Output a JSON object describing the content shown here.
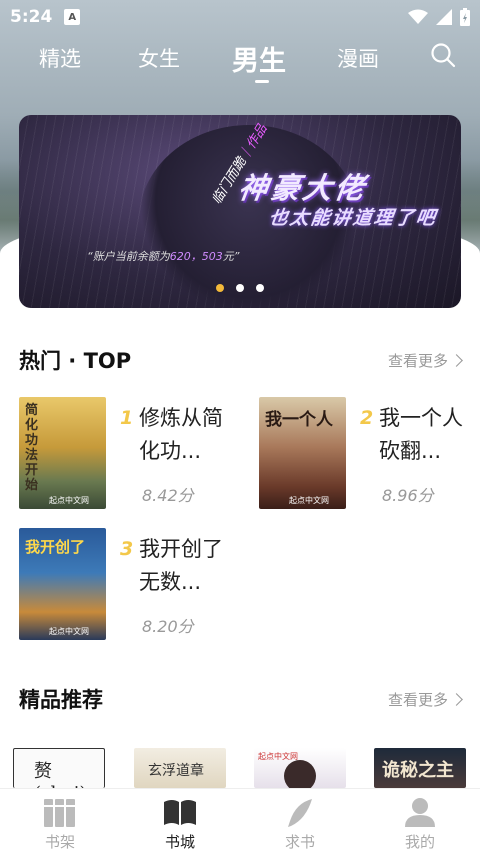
{
  "status_bar": {
    "time": "5:24",
    "a_badge": "A"
  },
  "tabs": [
    {
      "label": "精选",
      "active": false
    },
    {
      "label": "女生",
      "active": false
    },
    {
      "label": "男生",
      "active": true
    },
    {
      "label": "漫画",
      "active": false
    }
  ],
  "banner": {
    "title": "神豪大佬",
    "subtitle": "也太能讲道理了吧",
    "tag": "临门而跪",
    "tag_highlight": "｜作品",
    "quote_prefix": "“账户当前余额为",
    "quote_number": "620，503",
    "quote_suffix": "元”",
    "dots_count": 3,
    "active_dot": 0
  },
  "hot_section": {
    "title": "热门 · TOP",
    "more": "查看更多",
    "books": [
      {
        "rank": "1",
        "title": "修炼从简化功...",
        "score": "8.42分",
        "cover_text": "简化功法开始",
        "cover_publisher": "起点中文网"
      },
      {
        "rank": "2",
        "title": "我一个人砍翻...",
        "score": "8.96分",
        "cover_text": "我一个人",
        "cover_publisher": "起点中文网"
      },
      {
        "rank": "3",
        "title": "我开创了无数...",
        "score": "8.20分",
        "cover_text": "我开创了",
        "cover_publisher": "起点中文网"
      }
    ]
  },
  "rec_section": {
    "title": "精品推荐",
    "more": "查看更多",
    "covers": [
      {
        "text": "赘(zhui)"
      },
      {
        "text": "玄浮道章"
      },
      {
        "text": "起点中文网"
      },
      {
        "text": "诡秘之主"
      }
    ]
  },
  "bottom_nav": [
    {
      "label": "书架",
      "icon": "bookshelf-icon",
      "active": false
    },
    {
      "label": "书城",
      "icon": "open-book-icon",
      "active": true
    },
    {
      "label": "求书",
      "icon": "feather-icon",
      "active": false
    },
    {
      "label": "我的",
      "icon": "person-icon",
      "active": false
    }
  ]
}
